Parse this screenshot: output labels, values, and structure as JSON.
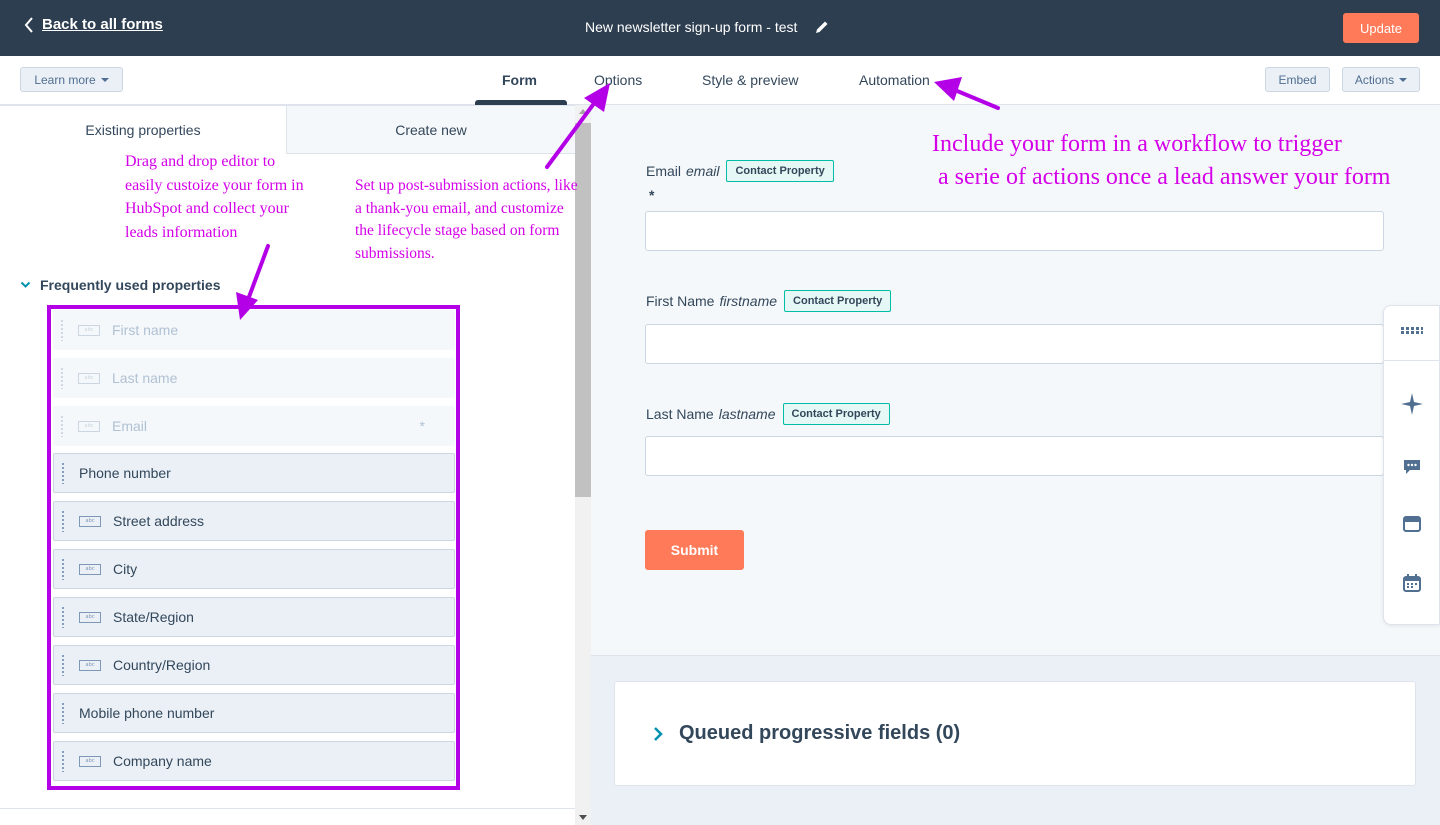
{
  "topbar": {
    "back_label": "Back to all forms",
    "form_title": "New newsletter sign-up form - test",
    "update_label": "Update"
  },
  "tabbar": {
    "learn_more_label": "Learn more",
    "tabs": [
      {
        "label": "Form",
        "active": true
      },
      {
        "label": "Options",
        "active": false
      },
      {
        "label": "Style & preview",
        "active": false
      },
      {
        "label": "Automation",
        "active": false
      }
    ],
    "embed_label": "Embed",
    "actions_label": "Actions"
  },
  "left_panel": {
    "subtabs": [
      {
        "label": "Existing properties",
        "active": true
      },
      {
        "label": "Create new",
        "active": false
      }
    ],
    "section_title": "Frequently used properties",
    "properties": [
      {
        "label": "First name",
        "disabled": true,
        "icon": "text-field-icon",
        "required": false
      },
      {
        "label": "Last name",
        "disabled": true,
        "icon": "text-field-icon",
        "required": false
      },
      {
        "label": "Email",
        "disabled": true,
        "icon": "text-field-icon",
        "required": true,
        "required_mark": "*"
      },
      {
        "label": "Phone number",
        "disabled": false,
        "icon": null
      },
      {
        "label": "Street address",
        "disabled": false,
        "icon": "text-field-icon"
      },
      {
        "label": "City",
        "disabled": false,
        "icon": "text-field-icon"
      },
      {
        "label": "State/Region",
        "disabled": false,
        "icon": "text-field-icon"
      },
      {
        "label": "Country/Region",
        "disabled": false,
        "icon": "text-field-icon"
      },
      {
        "label": "Mobile phone number",
        "disabled": false,
        "icon": null
      },
      {
        "label": "Company name",
        "disabled": false,
        "icon": "text-field-icon"
      }
    ],
    "icon_text": "abc"
  },
  "form_preview": {
    "fields": [
      {
        "label": "Email",
        "internal": "email",
        "badge": "Contact Property",
        "required_mark": "*"
      },
      {
        "label": "First Name",
        "internal": "firstname",
        "badge": "Contact Property"
      },
      {
        "label": "Last Name",
        "internal": "lastname",
        "badge": "Contact Property"
      }
    ],
    "submit_label": "Submit",
    "queued_label": "Queued progressive fields (0)"
  },
  "annotations": {
    "left": "Drag and drop editor to easily custoize your form in HubSpot and collect your leads information",
    "middle": "Set up post-submission actions, like a thank-you email, and customize the lifecycle stage based on form submissions.",
    "right_line1": "Include your form in a workflow to trigger",
    "right_line2": "a serie of actions once a lead answer your form"
  },
  "colors": {
    "topbar": "#2d3e50",
    "accent_orange": "#ff7a59",
    "annotation": "#d400e8",
    "badge_border": "#00bda5"
  },
  "side_rail_icons": [
    "grid-icon",
    "sparkle-icon",
    "chat-icon",
    "inbox-icon",
    "calendar-icon"
  ]
}
